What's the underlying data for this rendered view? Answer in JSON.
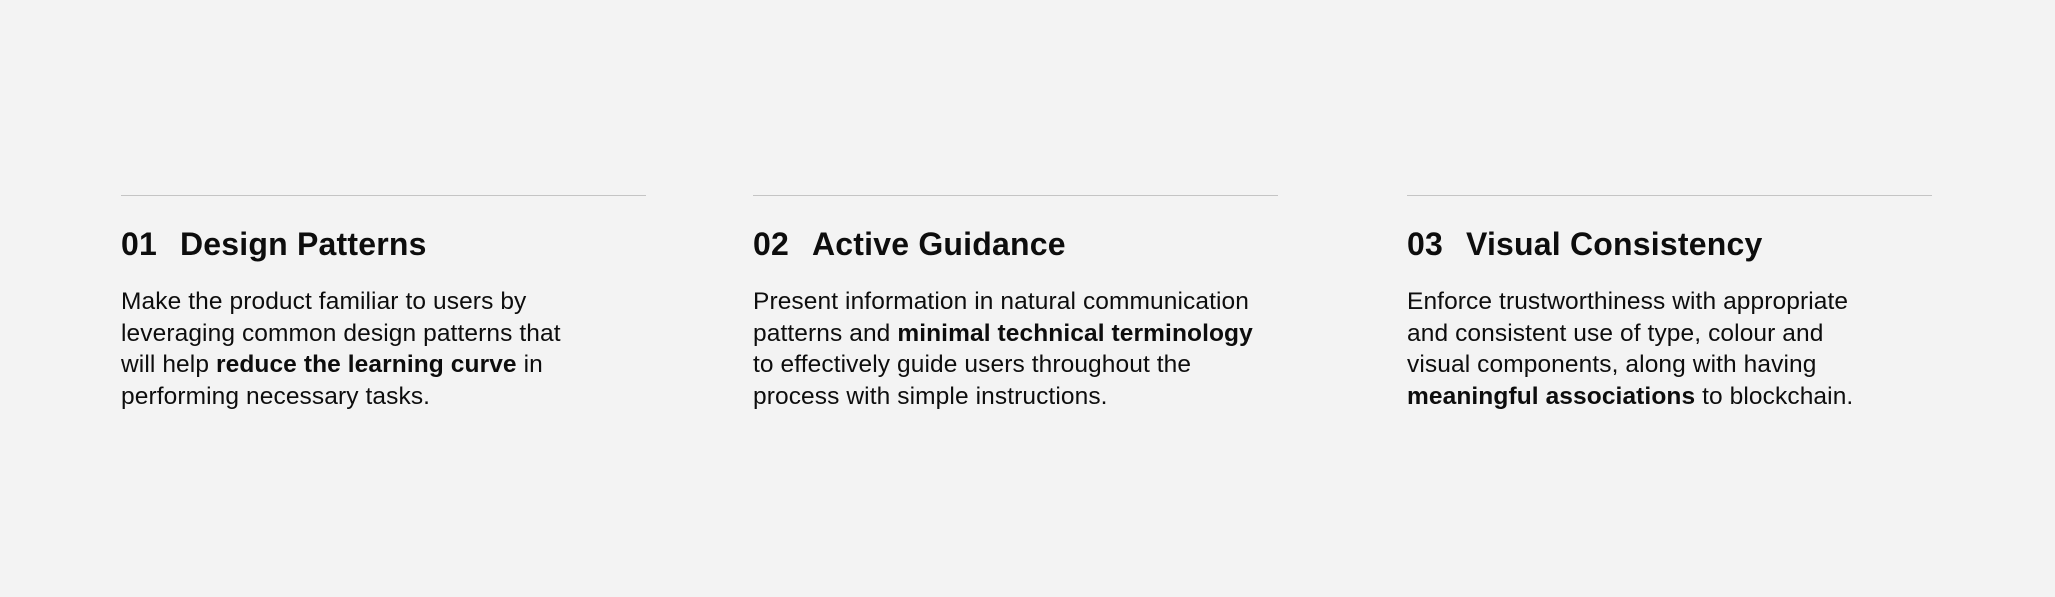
{
  "principles": [
    {
      "number": "01",
      "title": "Design Patterns",
      "lines": [
        [
          {
            "text": "Make the product familiar to users by",
            "bold": false
          }
        ],
        [
          {
            "text": "leveraging common design patterns that",
            "bold": false
          }
        ],
        [
          {
            "text": "will help ",
            "bold": false
          },
          {
            "text": "reduce the learning curve",
            "bold": true
          },
          {
            "text": " in",
            "bold": false
          }
        ],
        [
          {
            "text": "performing necessary tasks.",
            "bold": false
          }
        ]
      ]
    },
    {
      "number": "02",
      "title": "Active Guidance",
      "lines": [
        [
          {
            "text": "Present information in natural communication",
            "bold": false
          }
        ],
        [
          {
            "text": "patterns and ",
            "bold": false
          },
          {
            "text": "minimal technical terminology",
            "bold": true
          }
        ],
        [
          {
            "text": "to effectively guide users throughout the",
            "bold": false
          }
        ],
        [
          {
            "text": "process with simple instructions.",
            "bold": false
          }
        ]
      ]
    },
    {
      "number": "03",
      "title": "Visual Consistency",
      "lines": [
        [
          {
            "text": "Enforce trustworthiness with appropriate",
            "bold": false
          }
        ],
        [
          {
            "text": "and consistent use of type, colour and",
            "bold": false
          }
        ],
        [
          {
            "text": "visual components, along with having",
            "bold": false
          }
        ],
        [
          {
            "text": "meaningful associations",
            "bold": true
          },
          {
            "text": " to blockchain.",
            "bold": false
          }
        ]
      ]
    }
  ]
}
